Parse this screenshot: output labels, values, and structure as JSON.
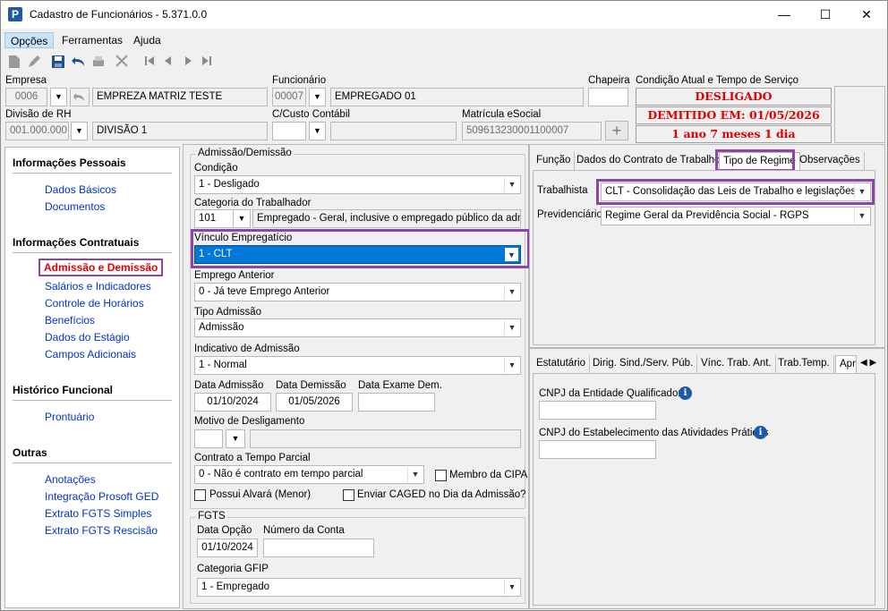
{
  "window": {
    "title": "Cadastro de Funcionários - 5.371.0.0",
    "icon_letter": "P",
    "controls": {
      "minimize": "—",
      "maximize": "☐",
      "close": "✕"
    }
  },
  "menu": {
    "items": [
      "Opções",
      "Ferramentas",
      "Ajuda"
    ]
  },
  "toolbar": {
    "icons": [
      "new-document-icon",
      "edit-icon",
      "save-icon",
      "undo-icon",
      "print-icon",
      "delete-icon",
      "first-record-icon",
      "previous-record-icon",
      "next-record-icon",
      "last-record-icon"
    ]
  },
  "header": {
    "empresa": {
      "label": "Empresa",
      "code": "0006",
      "name": "EMPREZA MATRIZ TESTE"
    },
    "funcionario": {
      "label": "Funcionário",
      "code": "00007",
      "name": "EMPREGADO 01"
    },
    "chapeira": {
      "label": "Chapeira",
      "value": ""
    },
    "condicao": {
      "label": "Condição Atual e Tempo de Serviço",
      "status": "DESLIGADO",
      "demitido": "DEMITIDO EM: 01/05/2026",
      "tempo": "1 ano 7 meses 1 dia"
    },
    "divisao": {
      "label": "Divisão de RH",
      "code": "001.000.000",
      "name": "DIVISÃO 1"
    },
    "ccusto": {
      "label": "C/Custo Contábil",
      "value": ""
    },
    "matricula": {
      "label": "Matrícula eSocial",
      "value": "509613230001100007"
    }
  },
  "sidebar": {
    "sections": [
      {
        "title": "Informações Pessoais",
        "items": [
          "Dados Básicos",
          "Documentos"
        ]
      },
      {
        "title": "Informações Contratuais",
        "items": [
          "Admissão e Demissão",
          "Salários e Indicadores",
          "Controle de Horários",
          "Benefícios",
          "Dados do Estágio",
          "Campos Adicionais"
        ]
      },
      {
        "title": "Histórico Funcional",
        "items": [
          "Prontuário"
        ]
      },
      {
        "title": "Outras",
        "items": [
          "Anotações",
          "Integração Prosoft GED",
          "Extrato FGTS Simples",
          "Extrato FGTS Rescisão"
        ]
      }
    ]
  },
  "admissao": {
    "group_title": "Admissão/Demissão",
    "condicao": {
      "label": "Condição",
      "value": "1 - Desligado"
    },
    "categoria": {
      "label": "Categoria do Trabalhador",
      "code": "101",
      "desc": "Empregado - Geral, inclusive o empregado público da administ"
    },
    "vinculo": {
      "label": "Vínculo Empregatício",
      "value": "1 - CLT"
    },
    "emprego_anterior": {
      "label": "Emprego Anterior",
      "value": "0 - Já teve Emprego Anterior"
    },
    "tipo_admissao": {
      "label": "Tipo Admissão",
      "value": "Admissão"
    },
    "indicativo": {
      "label": "Indicativo de Admissão",
      "value": "1 - Normal"
    },
    "data_admissao": {
      "label": "Data Admissão",
      "value": "01/10/2024"
    },
    "data_demissao": {
      "label": "Data Demissão",
      "value": "01/05/2026"
    },
    "data_exame": {
      "label": "Data Exame Dem.",
      "value": ""
    },
    "motivo": {
      "label": "Motivo de Desligamento",
      "value": ""
    },
    "contrato_parcial": {
      "label": "Contrato a Tempo Parcial",
      "value": "0 - Não é contrato em tempo parcial"
    },
    "membro_cipa": "Membro da CIPA",
    "possui_alvara": "Possui Alvará (Menor)",
    "enviar_caged": "Enviar CAGED no Dia da Admissão?"
  },
  "fgts": {
    "group_title": "FGTS",
    "data_opcao": {
      "label": "Data Opção",
      "value": "01/10/2024"
    },
    "numero_conta": {
      "label": "Número da Conta",
      "value": ""
    },
    "categoria_gfip": {
      "label": "Categoria GFIP",
      "value": "1 - Empregado"
    }
  },
  "right_tabs": {
    "tabs": [
      "Função",
      "Dados do Contrato de Trabalho",
      "Tipo de Regime",
      "Observações"
    ],
    "trabalhista": {
      "label": "Trabalhista",
      "value": "CLT - Consolidação das Leis de Trabalho e legislações trab"
    },
    "previdenciario": {
      "label": "Previdenciário",
      "value": "Regime Geral da Previdência Social - RGPS"
    }
  },
  "lower_tabs": {
    "tabs": [
      "Estatutário",
      "Dirig. Sind./Serv. Púb.",
      "Vínc. Trab. Ant.",
      "Trab.Temp.",
      "Apr"
    ],
    "cnpj_entidade": {
      "label": "CNPJ da Entidade Qualificadora",
      "value": ""
    },
    "cnpj_estab": {
      "label": "CNPJ do Estabelecimento das Atividades Práticas",
      "value": ""
    }
  }
}
